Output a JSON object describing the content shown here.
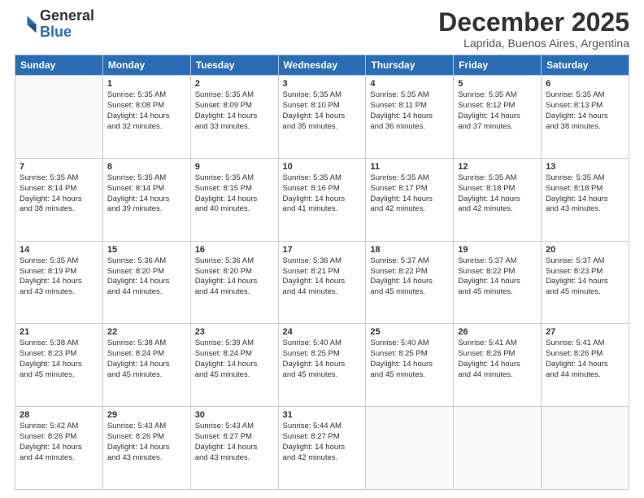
{
  "logo": {
    "general": "General",
    "blue": "Blue"
  },
  "header": {
    "month": "December 2025",
    "location": "Laprida, Buenos Aires, Argentina"
  },
  "weekdays": [
    "Sunday",
    "Monday",
    "Tuesday",
    "Wednesday",
    "Thursday",
    "Friday",
    "Saturday"
  ],
  "weeks": [
    [
      {
        "day": "",
        "sunrise": "",
        "sunset": "",
        "daylight": ""
      },
      {
        "day": "1",
        "sunrise": "Sunrise: 5:35 AM",
        "sunset": "Sunset: 8:08 PM",
        "daylight": "Daylight: 14 hours",
        "extra": "and 32 minutes."
      },
      {
        "day": "2",
        "sunrise": "Sunrise: 5:35 AM",
        "sunset": "Sunset: 8:09 PM",
        "daylight": "Daylight: 14 hours",
        "extra": "and 33 minutes."
      },
      {
        "day": "3",
        "sunrise": "Sunrise: 5:35 AM",
        "sunset": "Sunset: 8:10 PM",
        "daylight": "Daylight: 14 hours",
        "extra": "and 35 minutes."
      },
      {
        "day": "4",
        "sunrise": "Sunrise: 5:35 AM",
        "sunset": "Sunset: 8:11 PM",
        "daylight": "Daylight: 14 hours",
        "extra": "and 36 minutes."
      },
      {
        "day": "5",
        "sunrise": "Sunrise: 5:35 AM",
        "sunset": "Sunset: 8:12 PM",
        "daylight": "Daylight: 14 hours",
        "extra": "and 37 minutes."
      },
      {
        "day": "6",
        "sunrise": "Sunrise: 5:35 AM",
        "sunset": "Sunset: 8:13 PM",
        "daylight": "Daylight: 14 hours",
        "extra": "and 38 minutes."
      }
    ],
    [
      {
        "day": "7",
        "sunrise": "Sunrise: 5:35 AM",
        "sunset": "Sunset: 8:14 PM",
        "daylight": "Daylight: 14 hours",
        "extra": "and 38 minutes."
      },
      {
        "day": "8",
        "sunrise": "Sunrise: 5:35 AM",
        "sunset": "Sunset: 8:14 PM",
        "daylight": "Daylight: 14 hours",
        "extra": "and 39 minutes."
      },
      {
        "day": "9",
        "sunrise": "Sunrise: 5:35 AM",
        "sunset": "Sunset: 8:15 PM",
        "daylight": "Daylight: 14 hours",
        "extra": "and 40 minutes."
      },
      {
        "day": "10",
        "sunrise": "Sunrise: 5:35 AM",
        "sunset": "Sunset: 8:16 PM",
        "daylight": "Daylight: 14 hours",
        "extra": "and 41 minutes."
      },
      {
        "day": "11",
        "sunrise": "Sunrise: 5:35 AM",
        "sunset": "Sunset: 8:17 PM",
        "daylight": "Daylight: 14 hours",
        "extra": "and 42 minutes."
      },
      {
        "day": "12",
        "sunrise": "Sunrise: 5:35 AM",
        "sunset": "Sunset: 8:18 PM",
        "daylight": "Daylight: 14 hours",
        "extra": "and 42 minutes."
      },
      {
        "day": "13",
        "sunrise": "Sunrise: 5:35 AM",
        "sunset": "Sunset: 8:18 PM",
        "daylight": "Daylight: 14 hours",
        "extra": "and 43 minutes."
      }
    ],
    [
      {
        "day": "14",
        "sunrise": "Sunrise: 5:35 AM",
        "sunset": "Sunset: 8:19 PM",
        "daylight": "Daylight: 14 hours",
        "extra": "and 43 minutes."
      },
      {
        "day": "15",
        "sunrise": "Sunrise: 5:36 AM",
        "sunset": "Sunset: 8:20 PM",
        "daylight": "Daylight: 14 hours",
        "extra": "and 44 minutes."
      },
      {
        "day": "16",
        "sunrise": "Sunrise: 5:36 AM",
        "sunset": "Sunset: 8:20 PM",
        "daylight": "Daylight: 14 hours",
        "extra": "and 44 minutes."
      },
      {
        "day": "17",
        "sunrise": "Sunrise: 5:36 AM",
        "sunset": "Sunset: 8:21 PM",
        "daylight": "Daylight: 14 hours",
        "extra": "and 44 minutes."
      },
      {
        "day": "18",
        "sunrise": "Sunrise: 5:37 AM",
        "sunset": "Sunset: 8:22 PM",
        "daylight": "Daylight: 14 hours",
        "extra": "and 45 minutes."
      },
      {
        "day": "19",
        "sunrise": "Sunrise: 5:37 AM",
        "sunset": "Sunset: 8:22 PM",
        "daylight": "Daylight: 14 hours",
        "extra": "and 45 minutes."
      },
      {
        "day": "20",
        "sunrise": "Sunrise: 5:37 AM",
        "sunset": "Sunset: 8:23 PM",
        "daylight": "Daylight: 14 hours",
        "extra": "and 45 minutes."
      }
    ],
    [
      {
        "day": "21",
        "sunrise": "Sunrise: 5:38 AM",
        "sunset": "Sunset: 8:23 PM",
        "daylight": "Daylight: 14 hours",
        "extra": "and 45 minutes."
      },
      {
        "day": "22",
        "sunrise": "Sunrise: 5:38 AM",
        "sunset": "Sunset: 8:24 PM",
        "daylight": "Daylight: 14 hours",
        "extra": "and 45 minutes."
      },
      {
        "day": "23",
        "sunrise": "Sunrise: 5:39 AM",
        "sunset": "Sunset: 8:24 PM",
        "daylight": "Daylight: 14 hours",
        "extra": "and 45 minutes."
      },
      {
        "day": "24",
        "sunrise": "Sunrise: 5:40 AM",
        "sunset": "Sunset: 8:25 PM",
        "daylight": "Daylight: 14 hours",
        "extra": "and 45 minutes."
      },
      {
        "day": "25",
        "sunrise": "Sunrise: 5:40 AM",
        "sunset": "Sunset: 8:25 PM",
        "daylight": "Daylight: 14 hours",
        "extra": "and 45 minutes."
      },
      {
        "day": "26",
        "sunrise": "Sunrise: 5:41 AM",
        "sunset": "Sunset: 8:26 PM",
        "daylight": "Daylight: 14 hours",
        "extra": "and 44 minutes."
      },
      {
        "day": "27",
        "sunrise": "Sunrise: 5:41 AM",
        "sunset": "Sunset: 8:26 PM",
        "daylight": "Daylight: 14 hours",
        "extra": "and 44 minutes."
      }
    ],
    [
      {
        "day": "28",
        "sunrise": "Sunrise: 5:42 AM",
        "sunset": "Sunset: 8:26 PM",
        "daylight": "Daylight: 14 hours",
        "extra": "and 44 minutes."
      },
      {
        "day": "29",
        "sunrise": "Sunrise: 5:43 AM",
        "sunset": "Sunset: 8:26 PM",
        "daylight": "Daylight: 14 hours",
        "extra": "and 43 minutes."
      },
      {
        "day": "30",
        "sunrise": "Sunrise: 5:43 AM",
        "sunset": "Sunset: 8:27 PM",
        "daylight": "Daylight: 14 hours",
        "extra": "and 43 minutes."
      },
      {
        "day": "31",
        "sunrise": "Sunrise: 5:44 AM",
        "sunset": "Sunset: 8:27 PM",
        "daylight": "Daylight: 14 hours",
        "extra": "and 42 minutes."
      },
      {
        "day": "",
        "sunrise": "",
        "sunset": "",
        "daylight": "",
        "extra": ""
      },
      {
        "day": "",
        "sunrise": "",
        "sunset": "",
        "daylight": "",
        "extra": ""
      },
      {
        "day": "",
        "sunrise": "",
        "sunset": "",
        "daylight": "",
        "extra": ""
      }
    ]
  ]
}
